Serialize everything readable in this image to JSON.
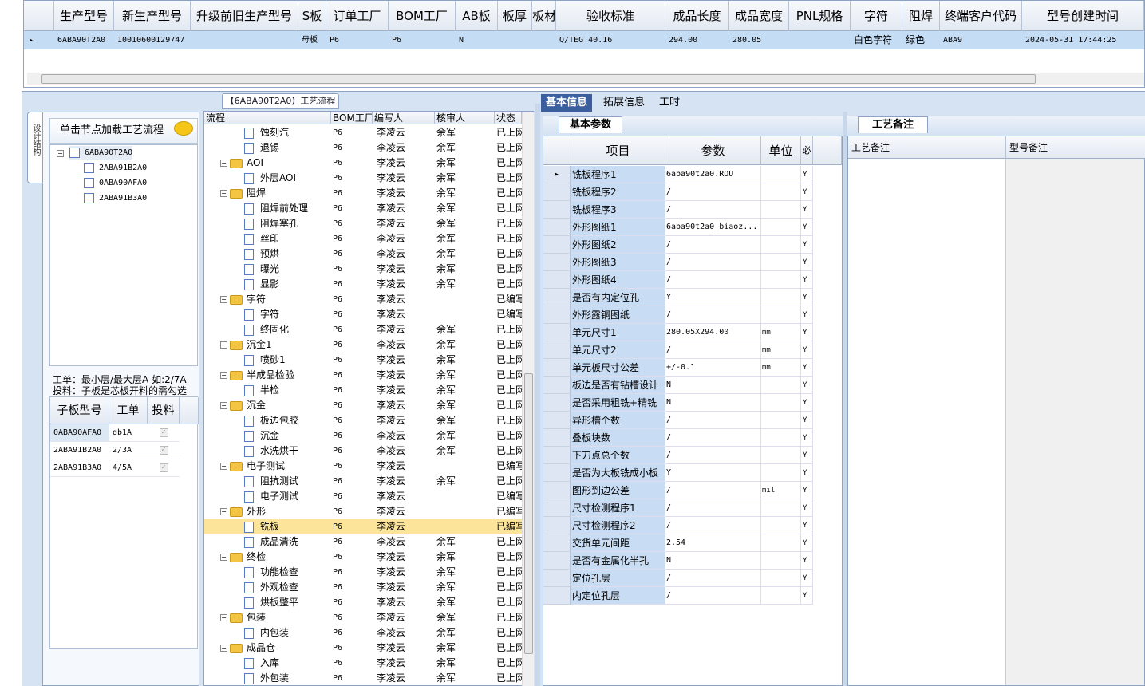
{
  "top_grid": {
    "columns": [
      "生产型号",
      "新生产型号",
      "升级前旧生产型号",
      "S板",
      "订单工厂",
      "BOM工厂",
      "AB板",
      "板厚",
      "板材",
      "验收标准",
      "成品长度",
      "成品宽度",
      "PNL规格",
      "字符",
      "阻焊",
      "终端客户代码",
      "型号创建时间"
    ],
    "row": [
      "6ABA90T2A0",
      "10010600129747",
      "",
      "母板",
      "P6",
      "P6",
      "N",
      "",
      "",
      "Q/TEG 40.16",
      "294.00",
      "280.05",
      "",
      "白色字符",
      "绿色",
      "ABA9",
      "2024-05-31 17:44:25"
    ]
  },
  "process_title": "【6ABA90T2A0】工艺流程",
  "left": {
    "vtab": "设计结构",
    "load_hint": "单击节点加载工艺流程",
    "tree_root": "6ABA90T2A0",
    "tree_children": [
      "2ABA91B2A0",
      "0ABA90AFA0",
      "2ABA91B3A0"
    ],
    "hint1": "工单：最小层/最大层A 如:2/7A",
    "hint2": "投料：子板是芯板开料的需勾选",
    "subgrid_headers": [
      "子板型号",
      "工单",
      "投料"
    ],
    "subgrid_rows": [
      {
        "model": "0ABA90AFA0",
        "order": "gb1A",
        "check": "✓"
      },
      {
        "model": "2ABA91B2A0",
        "order": "2/3A",
        "check": "✓"
      },
      {
        "model": "2ABA91B3A0",
        "order": "4/5A",
        "check": "✓"
      }
    ]
  },
  "tree": {
    "headers": [
      "流程",
      "BOM工厂",
      "编写人",
      "核审人",
      "状态"
    ],
    "rows": [
      {
        "lvl": 2,
        "name": "蚀刻汽",
        "bom": "P6",
        "w": "李凌云",
        "r": "余军",
        "s": "已上网"
      },
      {
        "lvl": 2,
        "name": "退锡",
        "bom": "P6",
        "w": "李凌云",
        "r": "余军",
        "s": "已上网"
      },
      {
        "lvl": 1,
        "name": "AOI",
        "bom": "P6",
        "w": "李凌云",
        "r": "余军",
        "s": "已上网"
      },
      {
        "lvl": 2,
        "name": "外层AOI",
        "bom": "P6",
        "w": "李凌云",
        "r": "余军",
        "s": "已上网"
      },
      {
        "lvl": 1,
        "name": "阻焊",
        "bom": "P6",
        "w": "李凌云",
        "r": "余军",
        "s": "已上网"
      },
      {
        "lvl": 2,
        "name": "阻焊前处理",
        "bom": "P6",
        "w": "李凌云",
        "r": "余军",
        "s": "已上网"
      },
      {
        "lvl": 2,
        "name": "阻焊塞孔",
        "bom": "P6",
        "w": "李凌云",
        "r": "余军",
        "s": "已上网"
      },
      {
        "lvl": 2,
        "name": "丝印",
        "bom": "P6",
        "w": "李凌云",
        "r": "余军",
        "s": "已上网"
      },
      {
        "lvl": 2,
        "name": "预烘",
        "bom": "P6",
        "w": "李凌云",
        "r": "余军",
        "s": "已上网"
      },
      {
        "lvl": 2,
        "name": "曝光",
        "bom": "P6",
        "w": "李凌云",
        "r": "余军",
        "s": "已上网"
      },
      {
        "lvl": 2,
        "name": "显影",
        "bom": "P6",
        "w": "李凌云",
        "r": "余军",
        "s": "已上网"
      },
      {
        "lvl": 1,
        "name": "字符",
        "bom": "P6",
        "w": "李凌云",
        "r": "",
        "s": "已编写"
      },
      {
        "lvl": 2,
        "name": "字符",
        "bom": "P6",
        "w": "李凌云",
        "r": "",
        "s": "已编写"
      },
      {
        "lvl": 2,
        "name": "终固化",
        "bom": "P6",
        "w": "李凌云",
        "r": "余军",
        "s": "已上网"
      },
      {
        "lvl": 1,
        "name": "沉金1",
        "bom": "P6",
        "w": "李凌云",
        "r": "余军",
        "s": "已上网"
      },
      {
        "lvl": 2,
        "name": "喷砂1",
        "bom": "P6",
        "w": "李凌云",
        "r": "余军",
        "s": "已上网"
      },
      {
        "lvl": 1,
        "name": "半成品检验",
        "bom": "P6",
        "w": "李凌云",
        "r": "余军",
        "s": "已上网"
      },
      {
        "lvl": 2,
        "name": "半检",
        "bom": "P6",
        "w": "李凌云",
        "r": "余军",
        "s": "已上网"
      },
      {
        "lvl": 1,
        "name": "沉金",
        "bom": "P6",
        "w": "李凌云",
        "r": "余军",
        "s": "已上网"
      },
      {
        "lvl": 2,
        "name": "板边包胶",
        "bom": "P6",
        "w": "李凌云",
        "r": "余军",
        "s": "已上网"
      },
      {
        "lvl": 2,
        "name": "沉金",
        "bom": "P6",
        "w": "李凌云",
        "r": "余军",
        "s": "已上网"
      },
      {
        "lvl": 2,
        "name": "水洗烘干",
        "bom": "P6",
        "w": "李凌云",
        "r": "余军",
        "s": "已上网"
      },
      {
        "lvl": 1,
        "name": "电子测试",
        "bom": "P6",
        "w": "李凌云",
        "r": "",
        "s": "已编写"
      },
      {
        "lvl": 2,
        "name": "阻抗测试",
        "bom": "P6",
        "w": "李凌云",
        "r": "余军",
        "s": "已上网"
      },
      {
        "lvl": 2,
        "name": "电子测试",
        "bom": "P6",
        "w": "李凌云",
        "r": "",
        "s": "已编写"
      },
      {
        "lvl": 1,
        "name": "外形",
        "bom": "P6",
        "w": "李凌云",
        "r": "",
        "s": "已编写"
      },
      {
        "lvl": 2,
        "name": "铣板",
        "bom": "P6",
        "w": "李凌云",
        "r": "",
        "s": "已编写",
        "sel": true
      },
      {
        "lvl": 2,
        "name": "成品清洗",
        "bom": "P6",
        "w": "李凌云",
        "r": "余军",
        "s": "已上网"
      },
      {
        "lvl": 1,
        "name": "终检",
        "bom": "P6",
        "w": "李凌云",
        "r": "余军",
        "s": "已上网"
      },
      {
        "lvl": 2,
        "name": "功能检查",
        "bom": "P6",
        "w": "李凌云",
        "r": "余军",
        "s": "已上网"
      },
      {
        "lvl": 2,
        "name": "外观检查",
        "bom": "P6",
        "w": "李凌云",
        "r": "余军",
        "s": "已上网"
      },
      {
        "lvl": 2,
        "name": "烘板整平",
        "bom": "P6",
        "w": "李凌云",
        "r": "余军",
        "s": "已上网"
      },
      {
        "lvl": 1,
        "name": "包装",
        "bom": "P6",
        "w": "李凌云",
        "r": "余军",
        "s": "已上网"
      },
      {
        "lvl": 2,
        "name": "内包装",
        "bom": "P6",
        "w": "李凌云",
        "r": "余军",
        "s": "已上网"
      },
      {
        "lvl": 1,
        "name": "成品仓",
        "bom": "P6",
        "w": "李凌云",
        "r": "余军",
        "s": "已上网"
      },
      {
        "lvl": 2,
        "name": "入库",
        "bom": "P6",
        "w": "李凌云",
        "r": "余军",
        "s": "已上网"
      },
      {
        "lvl": 2,
        "name": "外包装",
        "bom": "P6",
        "w": "李凌云",
        "r": "余军",
        "s": "已上网"
      }
    ]
  },
  "right_tabs": [
    "基本信息",
    "拓展信息",
    "工时"
  ],
  "param_tab": "基本参数",
  "param_headers": [
    "项目",
    "参数",
    "单位",
    "必"
  ],
  "params": [
    {
      "k": "铣板程序1",
      "v": "6aba90t2a0.ROU",
      "u": "",
      "y": "Y"
    },
    {
      "k": "铣板程序2",
      "v": "/",
      "u": "",
      "y": "Y"
    },
    {
      "k": "铣板程序3",
      "v": "/",
      "u": "",
      "y": "Y"
    },
    {
      "k": "外形图纸1",
      "v": "6aba90t2a0_biaoz...",
      "u": "",
      "y": "Y"
    },
    {
      "k": "外形图纸2",
      "v": "/",
      "u": "",
      "y": "Y"
    },
    {
      "k": "外形图纸3",
      "v": "/",
      "u": "",
      "y": "Y"
    },
    {
      "k": "外形图纸4",
      "v": "/",
      "u": "",
      "y": "Y"
    },
    {
      "k": "是否有内定位孔",
      "v": "Y",
      "u": "",
      "y": "Y"
    },
    {
      "k": "外形露铜图纸",
      "v": "/",
      "u": "",
      "y": "Y"
    },
    {
      "k": "单元尺寸1",
      "v": "280.05X294.00",
      "u": "mm",
      "y": "Y"
    },
    {
      "k": "单元尺寸2",
      "v": "/",
      "u": "mm",
      "y": "Y"
    },
    {
      "k": "单元板尺寸公差",
      "v": "+/-0.1",
      "u": "mm",
      "y": "Y"
    },
    {
      "k": "板边是否有钻槽设计",
      "v": "N",
      "u": "",
      "y": "Y"
    },
    {
      "k": "是否采用粗铣+精铣",
      "v": "N",
      "u": "",
      "y": "Y"
    },
    {
      "k": "异形槽个数",
      "v": "/",
      "u": "",
      "y": "Y"
    },
    {
      "k": "叠板块数",
      "v": "/",
      "u": "",
      "y": "Y"
    },
    {
      "k": "下刀点总个数",
      "v": "/",
      "u": "",
      "y": "Y"
    },
    {
      "k": "是否为大板铣成小板",
      "v": "Y",
      "u": "",
      "y": "Y"
    },
    {
      "k": "图形到边公差",
      "v": "/",
      "u": "mil",
      "y": "Y"
    },
    {
      "k": "尺寸检测程序1",
      "v": "/",
      "u": "",
      "y": "Y"
    },
    {
      "k": "尺寸检测程序2",
      "v": "/",
      "u": "",
      "y": "Y"
    },
    {
      "k": "交货单元间距",
      "v": "2.54",
      "u": "",
      "y": "Y"
    },
    {
      "k": "是否有金属化半孔",
      "v": "N",
      "u": "",
      "y": "Y"
    },
    {
      "k": "定位孔层",
      "v": "/",
      "u": "",
      "y": "Y"
    },
    {
      "k": "内定位孔层",
      "v": "/",
      "u": "",
      "y": "Y"
    }
  ],
  "notes_tab": "工艺备注",
  "notes_headers": [
    "工艺备注",
    "型号备注"
  ]
}
